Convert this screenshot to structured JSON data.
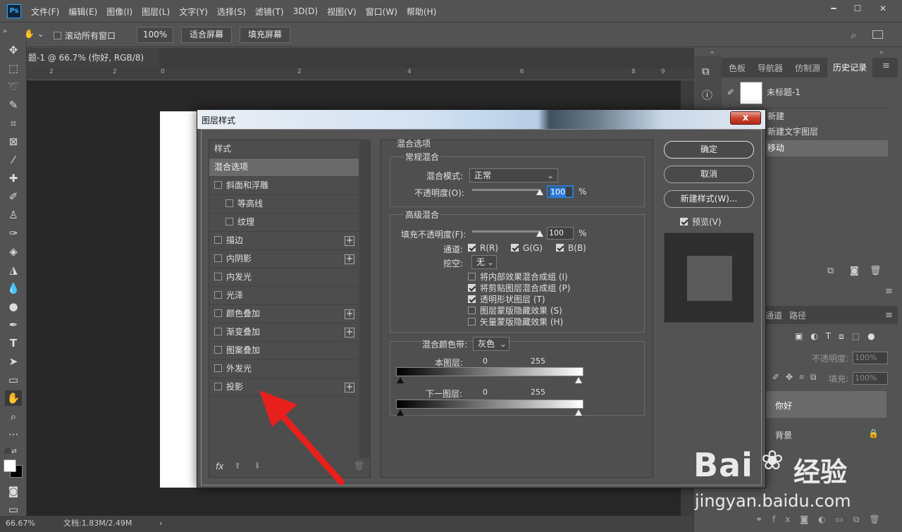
{
  "app": {
    "logo": "Ps",
    "menus": [
      "文件(F)",
      "编辑(E)",
      "图像(I)",
      "图层(L)",
      "文字(Y)",
      "选择(S)",
      "滤镜(T)",
      "3D(D)",
      "视图(V)",
      "窗口(W)",
      "帮助(H)"
    ]
  },
  "options": {
    "scroll_all": "滚动所有窗口",
    "zoom": "100%",
    "fit": "适合屏幕",
    "fill": "填充屏幕"
  },
  "document": {
    "tab": "题-1 @ 66.7% (你好, RGB/8) *",
    "ruler": [
      "2",
      "2",
      "0",
      "2",
      "4",
      "6",
      "8",
      "9"
    ]
  },
  "status": {
    "zoom": "66.67%",
    "doc": "文档:1.83M/2.49M"
  },
  "history": {
    "tabs": [
      "色板",
      "导航器",
      "仿制源",
      "历史记录"
    ],
    "snapshot": "未标题-1",
    "items": [
      "新建",
      "新建文字图层",
      "移动"
    ]
  },
  "layers": {
    "tabs": [
      "通道",
      "路径"
    ],
    "opacity_label": "不透明度:",
    "opacity": "100%",
    "fill_label": "填充:",
    "fill": "100%",
    "items": [
      "你好",
      "背景"
    ]
  },
  "dialog": {
    "title": "图层样式",
    "close": "x",
    "styles": [
      {
        "label": "样式",
        "indent": 0,
        "check": false,
        "plus": false,
        "sel": false
      },
      {
        "label": "混合选项",
        "indent": 0,
        "check": false,
        "plus": false,
        "sel": true
      },
      {
        "label": "斜面和浮雕",
        "indent": 0,
        "check": true,
        "plus": false,
        "sel": false
      },
      {
        "label": "等高线",
        "indent": 1,
        "check": true,
        "plus": false,
        "sel": false
      },
      {
        "label": "纹理",
        "indent": 1,
        "check": true,
        "plus": false,
        "sel": false
      },
      {
        "label": "描边",
        "indent": 0,
        "check": true,
        "plus": true,
        "sel": false
      },
      {
        "label": "内阴影",
        "indent": 0,
        "check": true,
        "plus": true,
        "sel": false
      },
      {
        "label": "内发光",
        "indent": 0,
        "check": true,
        "plus": false,
        "sel": false
      },
      {
        "label": "光泽",
        "indent": 0,
        "check": true,
        "plus": false,
        "sel": false
      },
      {
        "label": "颜色叠加",
        "indent": 0,
        "check": true,
        "plus": true,
        "sel": false
      },
      {
        "label": "渐变叠加",
        "indent": 0,
        "check": true,
        "plus": true,
        "sel": false
      },
      {
        "label": "图案叠加",
        "indent": 0,
        "check": true,
        "plus": false,
        "sel": false
      },
      {
        "label": "外发光",
        "indent": 0,
        "check": true,
        "plus": false,
        "sel": false
      },
      {
        "label": "投影",
        "indent": 0,
        "check": true,
        "plus": true,
        "sel": false
      }
    ],
    "fx": "fx",
    "blend_options": "混合选项",
    "general": "常规混合",
    "blend_mode_label": "混合模式:",
    "blend_mode": "正常",
    "opacity_label": "不透明度(O):",
    "opacity": "100",
    "percent": "%",
    "advanced": "高级混合",
    "fill_opacity_label": "填充不透明度(F):",
    "fill_opacity": "100",
    "channels_label": "通道:",
    "channels": [
      "R(R)",
      "G(G)",
      "B(B)"
    ],
    "knockout_label": "挖空:",
    "knockout": "无",
    "adv_options": [
      {
        "label": "将内部效果混合成组 (I)",
        "checked": false
      },
      {
        "label": "将剪贴图层混合成组 (P)",
        "checked": true
      },
      {
        "label": "透明形状图层 (T)",
        "checked": true
      },
      {
        "label": "图层蒙版隐藏效果 (S)",
        "checked": false
      },
      {
        "label": "矢量蒙版隐藏效果 (H)",
        "checked": false
      }
    ],
    "blend_if_label": "混合颜色带:",
    "blend_if": "灰色",
    "this_layer": "本图层:",
    "under_layer": "下一图层:",
    "v0": "0",
    "v255": "255",
    "ok": "确定",
    "cancel": "取消",
    "new_style": "新建样式(W)...",
    "preview": "预览(V)"
  },
  "watermark": {
    "brand": "Bai",
    "brand2": "经验",
    "url": "jingyan.baidu.com"
  },
  "colors": {
    "accent": "#31a8ff",
    "arrow": "#e8201c",
    "close": "#c8432f"
  }
}
